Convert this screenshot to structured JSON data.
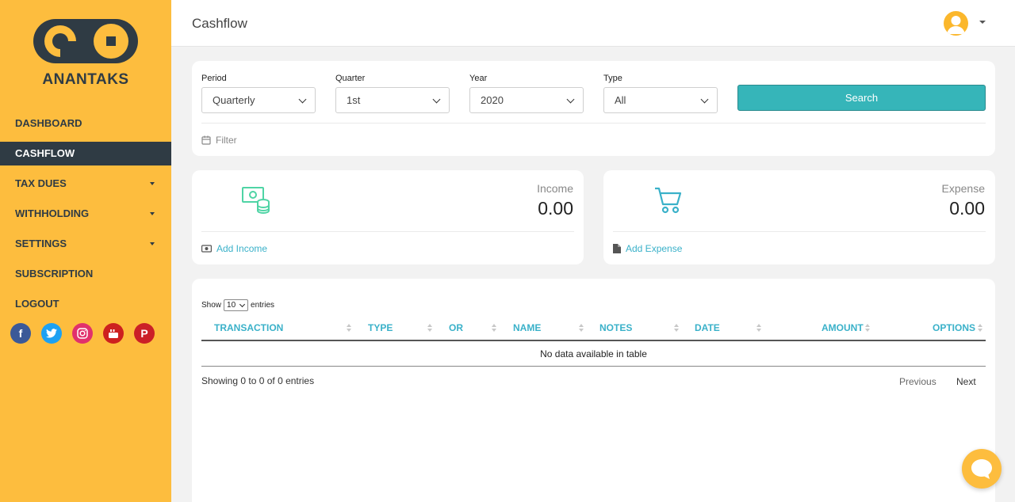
{
  "brand": {
    "name": "ANANTAKS",
    "logo_color": "#2f3b44",
    "accent": "#fdbd3e"
  },
  "sidebar": {
    "items": [
      {
        "label": "DASHBOARD",
        "active": false,
        "has_submenu": false
      },
      {
        "label": "CASHFLOW",
        "active": true,
        "has_submenu": false
      },
      {
        "label": "TAX DUES",
        "active": false,
        "has_submenu": true
      },
      {
        "label": "WITHHOLDING",
        "active": false,
        "has_submenu": true
      },
      {
        "label": "SETTINGS",
        "active": false,
        "has_submenu": true
      },
      {
        "label": "SUBSCRIPTION",
        "active": false,
        "has_submenu": false
      },
      {
        "label": "LOGOUT",
        "active": false,
        "has_submenu": false
      }
    ],
    "social": [
      {
        "icon": "facebook-icon",
        "glyph": "f",
        "color": "#3b5998"
      },
      {
        "icon": "twitter-icon",
        "glyph": "t",
        "color": "#1da1f2"
      },
      {
        "icon": "instagram-icon",
        "glyph": "◎",
        "color": "#e1306c"
      },
      {
        "icon": "youtube-icon",
        "glyph": "▶",
        "color": "#cd201f"
      },
      {
        "icon": "pinterest-icon",
        "glyph": "P",
        "color": "#cb2027"
      }
    ]
  },
  "header": {
    "title": "Cashflow",
    "avatar_icon": "user-avatar-icon"
  },
  "filters": {
    "period": {
      "label": "Period",
      "value": "Quarterly"
    },
    "quarter": {
      "label": "Quarter",
      "value": "1st"
    },
    "year": {
      "label": "Year",
      "value": "2020"
    },
    "type": {
      "label": "Type",
      "value": "All"
    },
    "search_label": "Search",
    "filter_label": "Filter",
    "button_color": "#36b5b9"
  },
  "income": {
    "label": "Income",
    "value": "0.00",
    "action": "Add Income",
    "icon": "money-coins-icon",
    "icon_color": "#4fd4a5"
  },
  "expense": {
    "label": "Expense",
    "value": "0.00",
    "action": "Add Expense",
    "icon": "shopping-cart-icon",
    "icon_color": "#3ab1c9"
  },
  "table": {
    "show_prefix": "Show",
    "page_size": "10",
    "show_suffix": "entries",
    "columns": [
      "TRANSACTION",
      "TYPE",
      "OR",
      "NAME",
      "NOTES",
      "DATE",
      "AMOUNT",
      "OPTIONS"
    ],
    "empty_text": "No data available in table",
    "info": "Showing 0 to 0 of 0 entries",
    "previous": "Previous",
    "next": "Next",
    "header_color": "#3ab1c9"
  },
  "chat": {
    "icon": "chat-bubble-icon"
  }
}
